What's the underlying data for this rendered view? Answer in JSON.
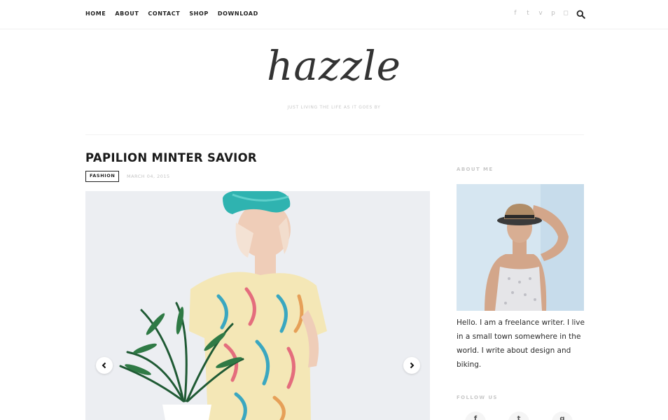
{
  "nav": {
    "items": [
      "HOME",
      "ABOUT",
      "CONTACT",
      "SHOP",
      "DOWNLOAD"
    ]
  },
  "social": {
    "icons": [
      "facebook-icon",
      "twitter-icon",
      "vimeo-icon",
      "pinterest-icon",
      "instagram-icon"
    ],
    "glyphs": [
      "f",
      "t",
      "v",
      "p",
      "◻"
    ]
  },
  "site": {
    "logo": "hazzle",
    "tagline": "JUST LIVING THE LIFE AS IT GOES BY"
  },
  "post": {
    "title": "PAPILION MINTER SAVIOR",
    "category": "FASHION",
    "date": "MARCH 04, 2015"
  },
  "sidebar": {
    "about_title": "ABOUT ME",
    "about_text": "Hello. I am a freelance writer. I live in a small town somewhere in the world. I write about design and biking.",
    "follow_title": "FOLLOW US",
    "follow_glyphs": [
      "f",
      "t",
      "g"
    ]
  },
  "colors": {
    "accent": "#1a1a1a",
    "muted": "#c8c8c8",
    "turban": "#2fb3b0"
  }
}
